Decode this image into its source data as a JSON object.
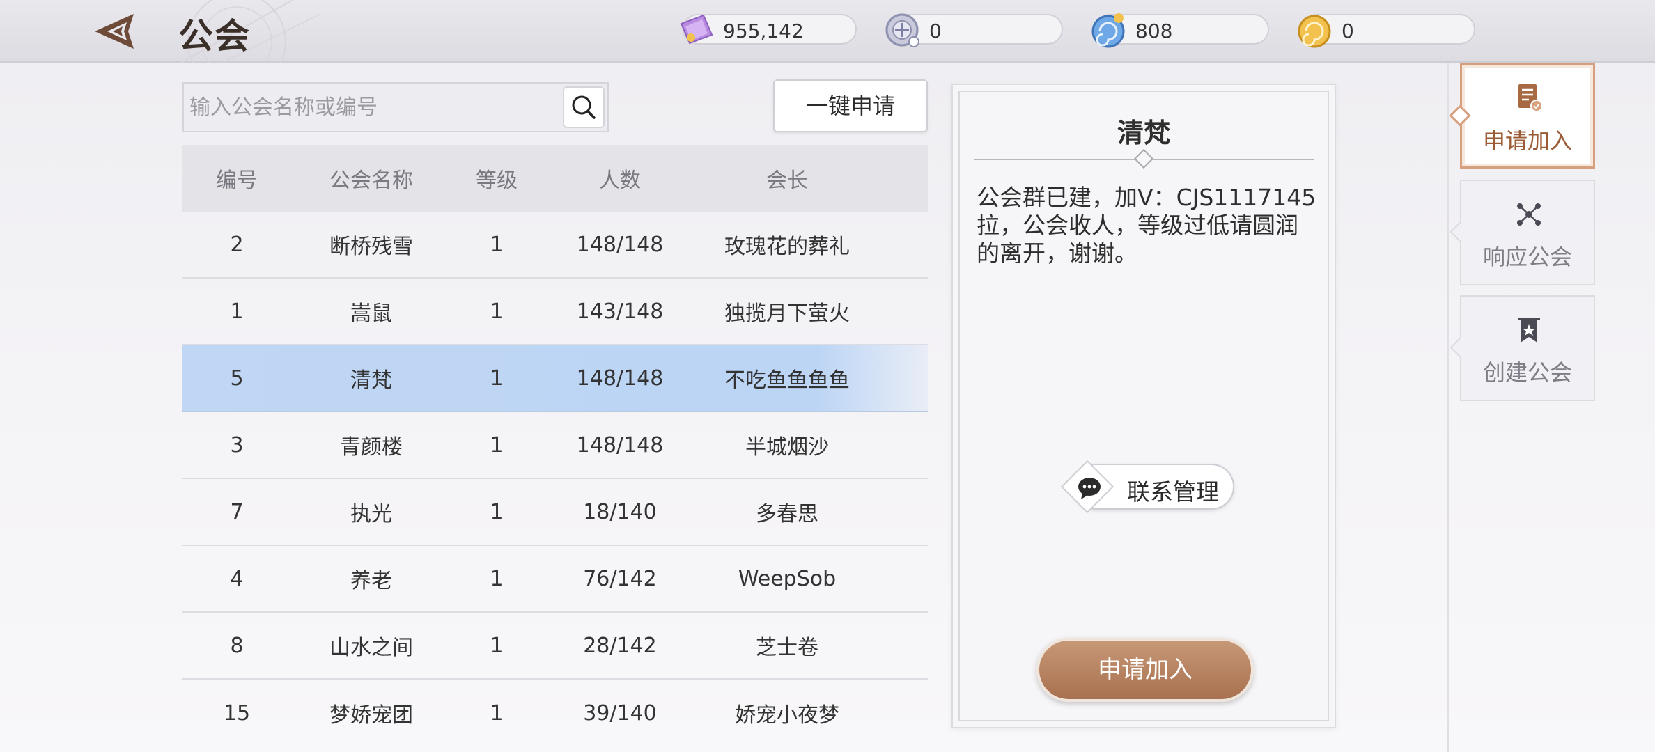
{
  "header": {
    "title": "公会",
    "currencies": [
      {
        "icon": "ticket-icon",
        "value": "955,142"
      },
      {
        "icon": "coin-plus-icon",
        "value": "0"
      },
      {
        "icon": "blue-shell-icon",
        "value": "808"
      },
      {
        "icon": "gold-shell-icon",
        "value": "0"
      }
    ]
  },
  "search": {
    "placeholder": "输入公会名称或编号",
    "value": "",
    "one_key_label": "一键申请"
  },
  "table": {
    "headers": [
      "编号",
      "公会名称",
      "等级",
      "人数",
      "会长"
    ],
    "rows": [
      {
        "id": "2",
        "name": "断桥残雪",
        "level": "1",
        "members": "148/148",
        "leader": "玫瑰花的葬礼",
        "selected": false
      },
      {
        "id": "1",
        "name": "嵩鼠",
        "level": "1",
        "members": "143/148",
        "leader": "独揽月下萤火",
        "selected": false
      },
      {
        "id": "5",
        "name": "清梵",
        "level": "1",
        "members": "148/148",
        "leader": "不吃鱼鱼鱼鱼",
        "selected": true
      },
      {
        "id": "3",
        "name": "青颜楼",
        "level": "1",
        "members": "148/148",
        "leader": "半城烟沙",
        "selected": false
      },
      {
        "id": "7",
        "name": "执光",
        "level": "1",
        "members": "18/140",
        "leader": "多春思",
        "selected": false
      },
      {
        "id": "4",
        "name": "养老",
        "level": "1",
        "members": "76/142",
        "leader": "WeepSob",
        "selected": false
      },
      {
        "id": "8",
        "name": "山水之间",
        "level": "1",
        "members": "28/142",
        "leader": "芝士卷",
        "selected": false
      },
      {
        "id": "15",
        "name": "梦娇宠团",
        "level": "1",
        "members": "39/140",
        "leader": "娇宠小夜梦",
        "selected": false
      }
    ]
  },
  "detail": {
    "title": "清梵",
    "description": "公会群已建，加V：CJS1117145拉，公会收人，等级过低请圆润的离开，谢谢。",
    "contact_label": "联系管理",
    "apply_label": "申请加入"
  },
  "side_tabs": [
    {
      "label": "申请加入",
      "icon": "application-doc-icon",
      "active": true
    },
    {
      "label": "响应公会",
      "icon": "network-icon",
      "active": false
    },
    {
      "label": "创建公会",
      "icon": "banner-icon",
      "active": false
    }
  ],
  "colors": {
    "accent": "#a8714f",
    "selected_row": "#bfd6f4",
    "active_tab_border": "#d6a07f"
  }
}
